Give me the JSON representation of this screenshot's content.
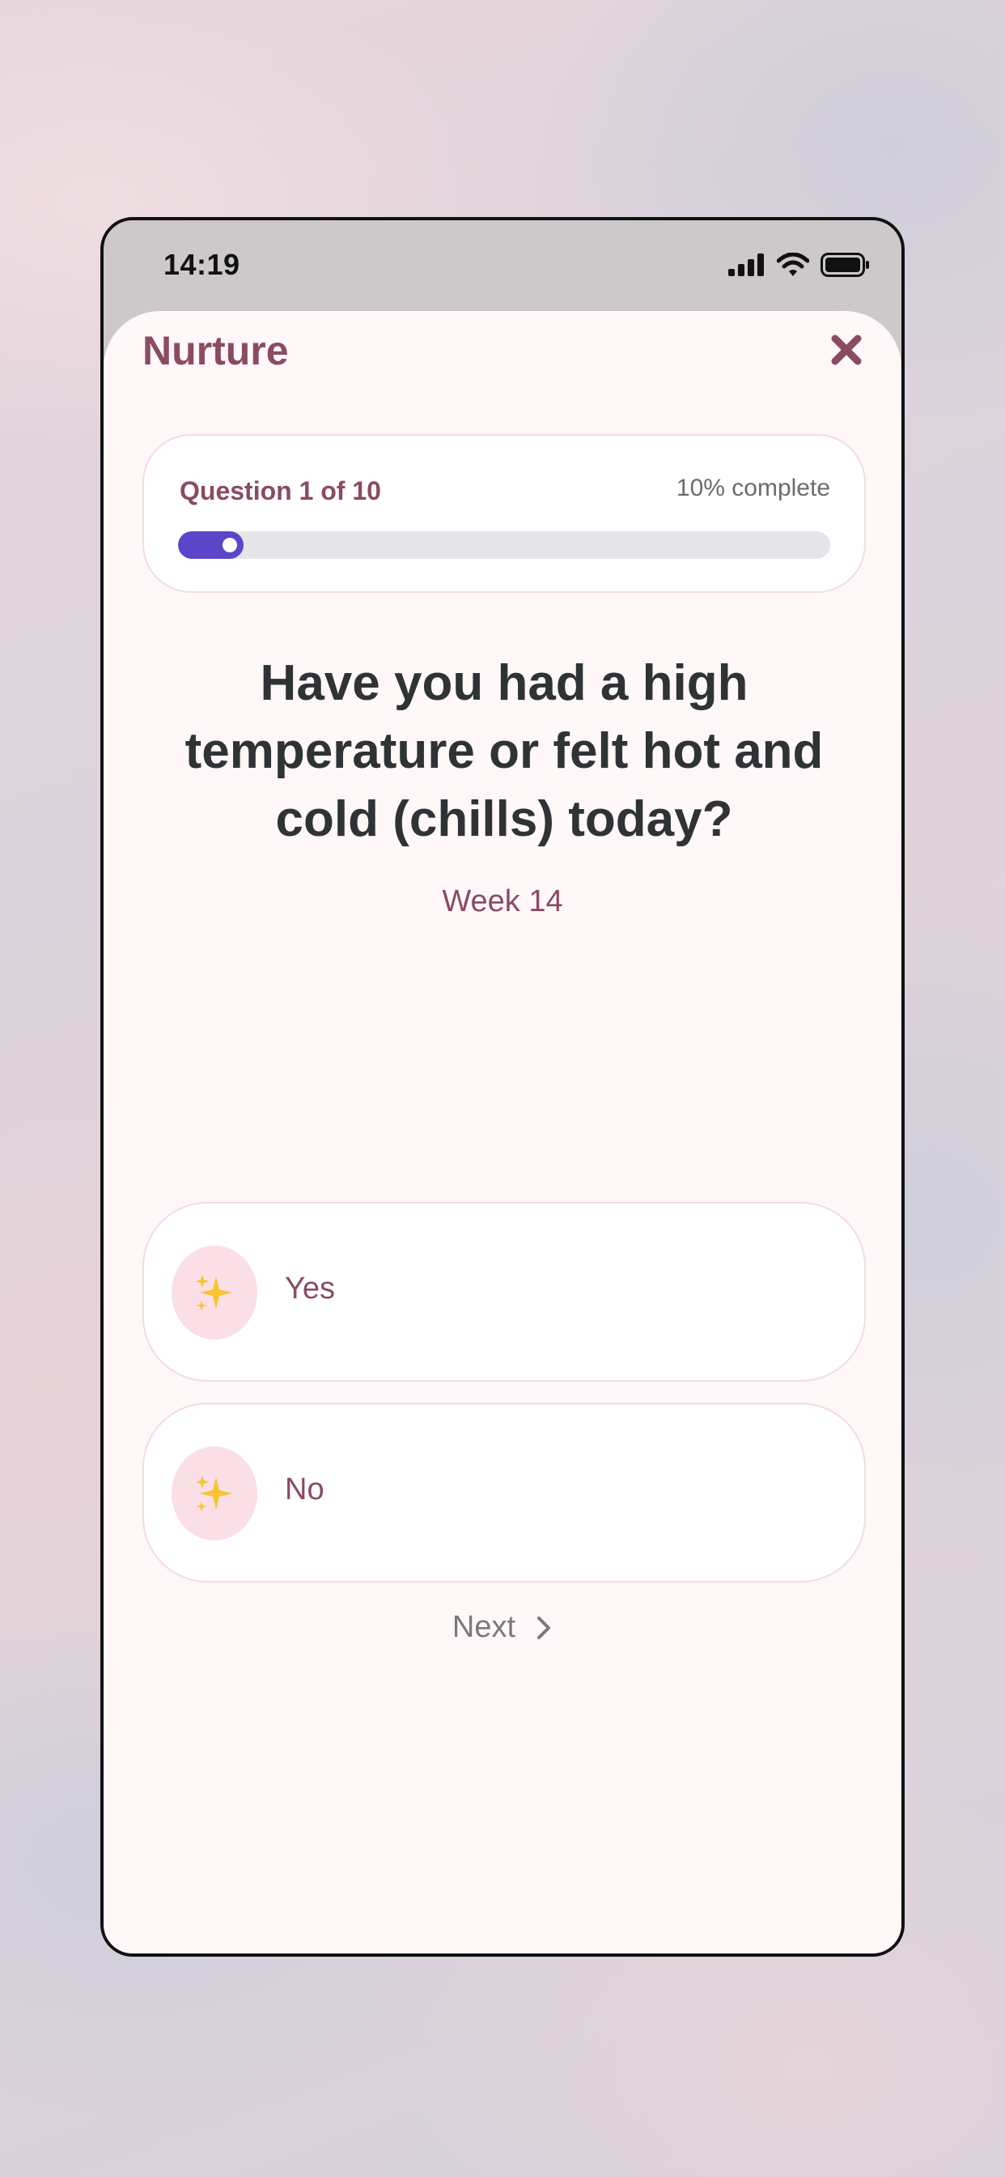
{
  "status_bar": {
    "time": "14:19",
    "icons": [
      "cellular-signal-icon",
      "wifi-icon",
      "battery-icon"
    ]
  },
  "header": {
    "title": "Nurture",
    "close_icon": "close-icon"
  },
  "progress": {
    "question_label": "Question 1 of 10",
    "percent_label": "10% complete",
    "fraction": 0.1
  },
  "question": {
    "text": "Have you had a high temperature or felt hot and cold (chills) today?",
    "week_label": "Week 14"
  },
  "options": [
    {
      "label": "Yes",
      "icon": "sparkles-icon"
    },
    {
      "label": "No",
      "icon": "sparkles-icon"
    }
  ],
  "footer": {
    "next_label": "Next",
    "next_icon": "chevron-right-icon"
  },
  "colors": {
    "brand": "#8b4b63",
    "progress_fill": "#5b45c9",
    "sheet_background": "#fff7f8",
    "option_icon_background": "#fbdfe6"
  }
}
